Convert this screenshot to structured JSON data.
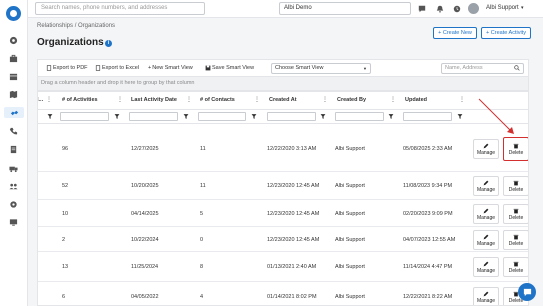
{
  "search": {
    "placeholder": "Search names, phone numbers, and addresses"
  },
  "company": {
    "name": "Albi Demo"
  },
  "user": {
    "name": "Albi Support"
  },
  "breadcrumb": "Relationships / Organizations",
  "page": {
    "title": "Organizations",
    "new_button": "+ Create New",
    "activity_button": "+ Create Activity"
  },
  "toolbar": {
    "export_pdf": "Export to PDF",
    "export_excel": "Export to Excel",
    "new_smart_view": "New Smart View",
    "save_smart_view": "Save Smart View",
    "smart_view_select": "Choose Smart View",
    "grid_search_placeholder": "Name, Address"
  },
  "group_panel_hint": "Drag a column header and drop it here to group by that column",
  "columns": {
    "c0": "I...",
    "c1": "# of Activities",
    "c2": "Last Activity Date",
    "c3": "# of Contacts",
    "c4": "Created At",
    "c5": "Created By",
    "c6": "Updated"
  },
  "actions": {
    "manage": "Manage",
    "delete": "Delete"
  },
  "rows": [
    {
      "activities": "96",
      "last_activity": "12/27/2025",
      "contacts": "11",
      "created_at": "12/22/2020 3:13 AM",
      "created_by": "Albi Support",
      "updated": "05/08/2025 2:33 AM"
    },
    {
      "activities": "52",
      "last_activity": "10/20/2025",
      "contacts": "11",
      "created_at": "12/23/2020 12:45 AM",
      "created_by": "Albi Support",
      "updated": "11/08/2023 9:34 PM"
    },
    {
      "activities": "10",
      "last_activity": "04/14/2025",
      "contacts": "5",
      "created_at": "12/23/2020 12:45 AM",
      "created_by": "Albi Support",
      "updated": "02/20/2023 9:09 PM"
    },
    {
      "activities": "2",
      "last_activity": "10/22/2024",
      "contacts": "0",
      "created_at": "12/23/2020 12:45 AM",
      "created_by": "Albi Support",
      "updated": "04/07/2023 12:55 AM"
    },
    {
      "activities": "13",
      "last_activity": "11/25/2024",
      "contacts": "8",
      "created_at": "01/13/2021 2:40 AM",
      "created_by": "Albi Support",
      "updated": "11/14/2024 4:47 PM"
    },
    {
      "activities": "6",
      "last_activity": "04/05/2022",
      "contacts": "4",
      "created_at": "01/14/2021 8:02 PM",
      "created_by": "Albi Support",
      "updated": "12/22/2021 8:22 AM"
    }
  ],
  "colors": {
    "accent": "#1f74c8",
    "highlight": "#d32f2f"
  }
}
